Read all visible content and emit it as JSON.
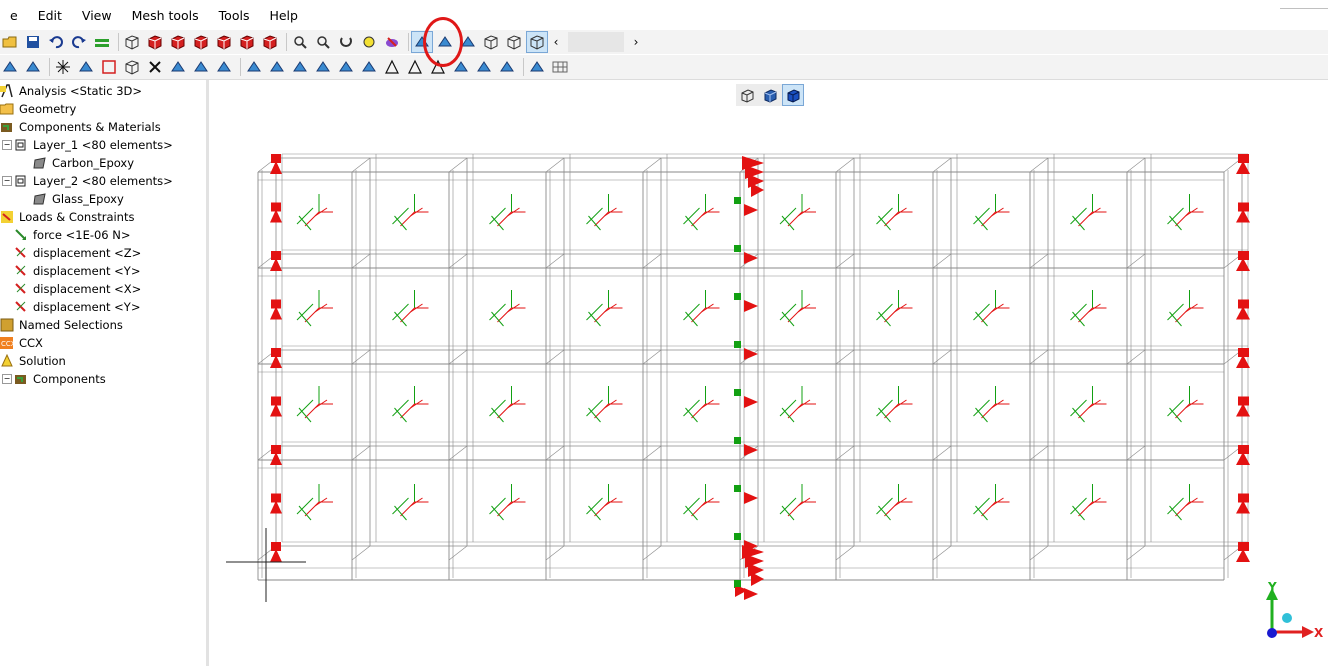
{
  "menu": [
    "e",
    "Edit",
    "View",
    "Mesh tools",
    "Tools",
    "Help"
  ],
  "toolbar1_icons": [
    "open-icon",
    "save-icon",
    "undo-icon",
    "redo-icon",
    "layers-icon",
    "wireframe-cube-icon",
    "red-cube-icon",
    "red-cube-front-icon",
    "red-cube-side-icon",
    "red-cube-top-icon",
    "red-cube-iso-icon",
    "red-cube-back-icon",
    "zoom-box-icon",
    "zoom-icon",
    "rotate-icon",
    "pan-icon",
    "render-icon",
    "select-nodes-icon",
    "select-elements-icon",
    "surface-icon",
    "solid-icon",
    "edges-icon",
    "mesh-cube-icon"
  ],
  "toolbar2_icons": [
    "pointer-icon",
    "pick-curve-icon",
    "node-star-icon",
    "node-pick-icon",
    "rect-select-icon",
    "cube-select-icon",
    "close-x-icon",
    "align-icon",
    "bracket-icon",
    "connect-icon",
    "connect2-icon",
    "cylinder-icon",
    "arch-icon",
    "spline-icon",
    "branch-icon",
    "fork-icon",
    "triangle-stamp-icon",
    "triangle-icon",
    "triangle2-icon",
    "tube-icon",
    "dish-icon",
    "film-icon",
    "flow-icon",
    "grid-icon"
  ],
  "tree": {
    "items": [
      {
        "label": "Analysis <Static 3D>",
        "icon": "analysis-icon",
        "level": 0
      },
      {
        "label": "Geometry",
        "icon": "folder-icon",
        "level": 0
      },
      {
        "label": "Components & Materials",
        "icon": "components-icon",
        "level": 0
      },
      {
        "label": "Layer_1 <80 elements>",
        "icon": "layer-icon",
        "level": 1
      },
      {
        "label": "Carbon_Epoxy",
        "icon": "material-icon",
        "level": 2
      },
      {
        "label": "Layer_2 <80 elements>",
        "icon": "layer-icon",
        "level": 1
      },
      {
        "label": "Glass_Epoxy",
        "icon": "material-icon",
        "level": 2
      },
      {
        "label": "Loads & Constraints",
        "icon": "loads-icon",
        "level": 0
      },
      {
        "label": "force <1E-06 N>",
        "icon": "force-icon",
        "level": 1
      },
      {
        "label": "displacement <Z>",
        "icon": "displacement-icon",
        "level": 1
      },
      {
        "label": "displacement <Y>",
        "icon": "displacement-icon",
        "level": 1
      },
      {
        "label": "displacement <X>",
        "icon": "displacement-icon",
        "level": 1
      },
      {
        "label": "displacement <Y>",
        "icon": "displacement-icon",
        "level": 1
      },
      {
        "label": "Named Selections",
        "icon": "named-selections-icon",
        "level": 0
      },
      {
        "label": "CCX",
        "icon": "ccx-icon",
        "level": 0
      },
      {
        "label": "Solution",
        "icon": "solution-icon",
        "level": 0
      },
      {
        "label": "Components",
        "icon": "components-icon",
        "level": 1
      }
    ]
  },
  "axis_labels": {
    "y": "Y",
    "x": "X"
  },
  "colors": {
    "constraint": "#e31212",
    "node": "#12a012",
    "mesh": "#8a8a8a",
    "annotation": "#e01818"
  }
}
